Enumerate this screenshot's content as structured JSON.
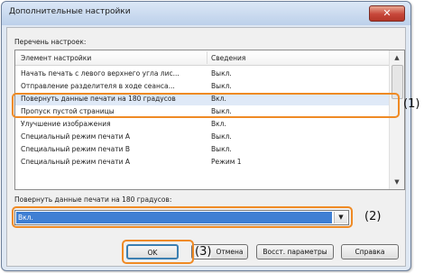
{
  "window": {
    "title": "Дополнительные настройки",
    "close_glyph": "✕"
  },
  "settings_list": {
    "label": "Перечень настроек:",
    "columns": [
      "Элемент настройки",
      "Сведения"
    ],
    "rows": [
      {
        "item": "Начать печать с левого верхнего угла лис...",
        "value": "Выкл."
      },
      {
        "item": "Отправление разделителя в ходе сеанса...",
        "value": "Выкл."
      },
      {
        "item": "Повернуть данные печати на 180 градусов",
        "value": "Вкл."
      },
      {
        "item": "Пропуск пустой страницы",
        "value": "Выкл."
      },
      {
        "item": "Улучшение изображения",
        "value": "Вкл."
      },
      {
        "item": "Специальный режим печати A",
        "value": "Выкл."
      },
      {
        "item": "Специальный режим печати B",
        "value": "Выкл."
      },
      {
        "item": "Специальный режим печати A",
        "value": "Режим 1"
      }
    ],
    "selected_index": 2
  },
  "setting_combo": {
    "label": "Повернуть данные печати на 180 градусов:",
    "value": "Вкл."
  },
  "buttons": {
    "ok": "OK",
    "cancel": "Отмена",
    "restore": "Восст. параметры",
    "help": "Справка"
  },
  "callouts": [
    "(1)",
    "(2)",
    "(3)"
  ],
  "colors": {
    "callout": "#ef8a24",
    "selection": "#3f7fd3"
  }
}
